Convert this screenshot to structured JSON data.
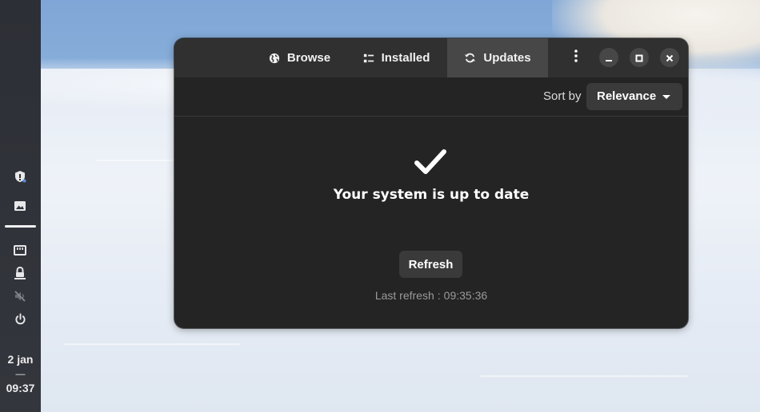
{
  "panel": {
    "icons": [
      "shield-icon",
      "image-icon",
      "network-wired-icon",
      "lock-icon",
      "volume-muted-icon",
      "power-icon"
    ],
    "clock": {
      "date": "2 jan",
      "separator": "—",
      "time": "09:37"
    }
  },
  "window": {
    "tabs": [
      {
        "label": "Browse",
        "icon": "globe-icon",
        "active": false
      },
      {
        "label": "Installed",
        "icon": "list-icon",
        "active": false
      },
      {
        "label": "Updates",
        "icon": "refresh-icon",
        "active": true
      }
    ],
    "controls": [
      "more-menu-icon",
      "minimize-icon",
      "maximize-icon",
      "close-icon"
    ]
  },
  "toolbar": {
    "sort_label": "Sort by",
    "sort_value": "Relevance"
  },
  "status": {
    "icon": "checkmark-icon",
    "title": "Your system is up to date",
    "refresh_button": "Refresh",
    "last_refresh_label": "Last refresh",
    "last_refresh_separator": ":",
    "last_refresh_time": "09:35:36"
  },
  "colors": {
    "window_bg": "#242424",
    "headerbar_bg": "#303030",
    "active_tab_bg": "#474747",
    "button_bg": "#3a3a3a",
    "muted_text": "#9a9a9a"
  }
}
